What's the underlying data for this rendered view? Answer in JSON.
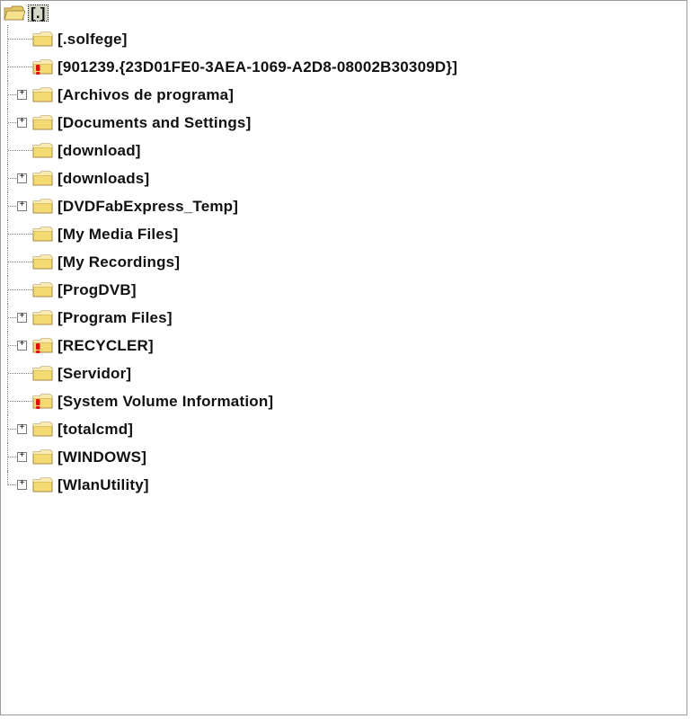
{
  "root": {
    "label": "[.]"
  },
  "items": [
    {
      "label": "[.solfege]",
      "expandable": false,
      "icon": "folder"
    },
    {
      "label": "[901239.{23D01FE0-3AEA-1069-A2D8-08002B30309D}]",
      "expandable": false,
      "icon": "alert"
    },
    {
      "label": "[Archivos de programa]",
      "expandable": true,
      "icon": "folder"
    },
    {
      "label": "[Documents and Settings]",
      "expandable": true,
      "icon": "folder"
    },
    {
      "label": "[download]",
      "expandable": false,
      "icon": "folder"
    },
    {
      "label": "[downloads]",
      "expandable": true,
      "icon": "folder"
    },
    {
      "label": "[DVDFabExpress_Temp]",
      "expandable": true,
      "icon": "folder"
    },
    {
      "label": "[My Media Files]",
      "expandable": false,
      "icon": "folder"
    },
    {
      "label": "[My Recordings]",
      "expandable": false,
      "icon": "folder"
    },
    {
      "label": "[ProgDVB]",
      "expandable": false,
      "icon": "folder"
    },
    {
      "label": "[Program Files]",
      "expandable": true,
      "icon": "folder"
    },
    {
      "label": "[RECYCLER]",
      "expandable": true,
      "icon": "alert"
    },
    {
      "label": "[Servidor]",
      "expandable": false,
      "icon": "folder"
    },
    {
      "label": "[System Volume Information]",
      "expandable": false,
      "icon": "alert"
    },
    {
      "label": "[totalcmd]",
      "expandable": true,
      "icon": "folder"
    },
    {
      "label": "[WINDOWS]",
      "expandable": true,
      "icon": "folder"
    },
    {
      "label": "[WlanUtility]",
      "expandable": true,
      "icon": "folder"
    }
  ],
  "expander_glyph": "+"
}
